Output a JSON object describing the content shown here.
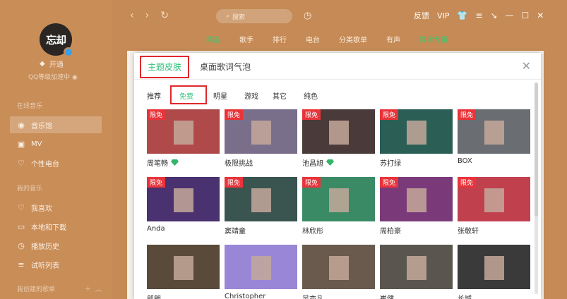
{
  "sidebar": {
    "avatar_text": "忘却",
    "vip_label": "开通",
    "qq_level": "QQ等级加速中",
    "section_online": "在线音乐",
    "online_items": [
      {
        "label": "音乐馆",
        "icon": "music-hall-icon",
        "glyph": "◉"
      },
      {
        "label": "MV",
        "icon": "mv-icon",
        "glyph": "▣"
      },
      {
        "label": "个性电台",
        "icon": "radio-icon",
        "glyph": "♡"
      }
    ],
    "section_my": "我的音乐",
    "my_items": [
      {
        "label": "我喜欢",
        "icon": "heart-icon",
        "glyph": "♡"
      },
      {
        "label": "本地和下载",
        "icon": "monitor-icon",
        "glyph": "▭"
      },
      {
        "label": "播放历史",
        "icon": "clock-icon",
        "glyph": "◷"
      },
      {
        "label": "试听列表",
        "icon": "list-icon",
        "glyph": "≡"
      }
    ],
    "section_created": "我创建的歌单"
  },
  "topbar": {
    "search_placeholder": "搜索",
    "feedback": "反馈",
    "vip": "VIP",
    "tabs": [
      "精选",
      "歌手",
      "排行",
      "电台",
      "分类歌单",
      "有声",
      "数字专辑"
    ]
  },
  "modal": {
    "tab_skin": "主题皮肤",
    "tab_lyrics": "桌面歌词气泡",
    "subtabs": [
      "推荐",
      "免费",
      "明星",
      "游戏",
      "其它",
      "纯色"
    ],
    "tag": "限免",
    "cards": [
      {
        "name": "周笔畅",
        "gem": true,
        "tagged": true,
        "color": "#b04a4a"
      },
      {
        "name": "极限挑战",
        "gem": false,
        "tagged": true,
        "color": "#7a6f8a"
      },
      {
        "name": "池昌旭",
        "gem": true,
        "tagged": true,
        "color": "#4a3a3a"
      },
      {
        "name": "苏打绿",
        "gem": false,
        "tagged": true,
        "color": "#2b5f56"
      },
      {
        "name": "BOX",
        "gem": false,
        "tagged": true,
        "color": "#6a6e73"
      },
      {
        "name": "Anda",
        "gem": false,
        "tagged": true,
        "color": "#4a3170"
      },
      {
        "name": "窦靖童",
        "gem": false,
        "tagged": true,
        "color": "#3a5450"
      },
      {
        "name": "林欣彤",
        "gem": false,
        "tagged": true,
        "color": "#3a8a66"
      },
      {
        "name": "周柏豪",
        "gem": false,
        "tagged": true,
        "color": "#7a3a7a"
      },
      {
        "name": "张敬轩",
        "gem": false,
        "tagged": true,
        "color": "#c0404e"
      },
      {
        "name": "郎朗",
        "gem": false,
        "tagged": false,
        "color": "#5a4a3a"
      },
      {
        "name": "Christopher",
        "gem": false,
        "tagged": false,
        "color": "#9a86d6"
      },
      {
        "name": "吴亦凡",
        "gem": false,
        "tagged": false,
        "color": "#6a5a4e"
      },
      {
        "name": "崔健",
        "gem": false,
        "tagged": false,
        "color": "#5a564f"
      },
      {
        "name": "长城",
        "gem": false,
        "tagged": false,
        "color": "#3a3a3a"
      }
    ]
  }
}
